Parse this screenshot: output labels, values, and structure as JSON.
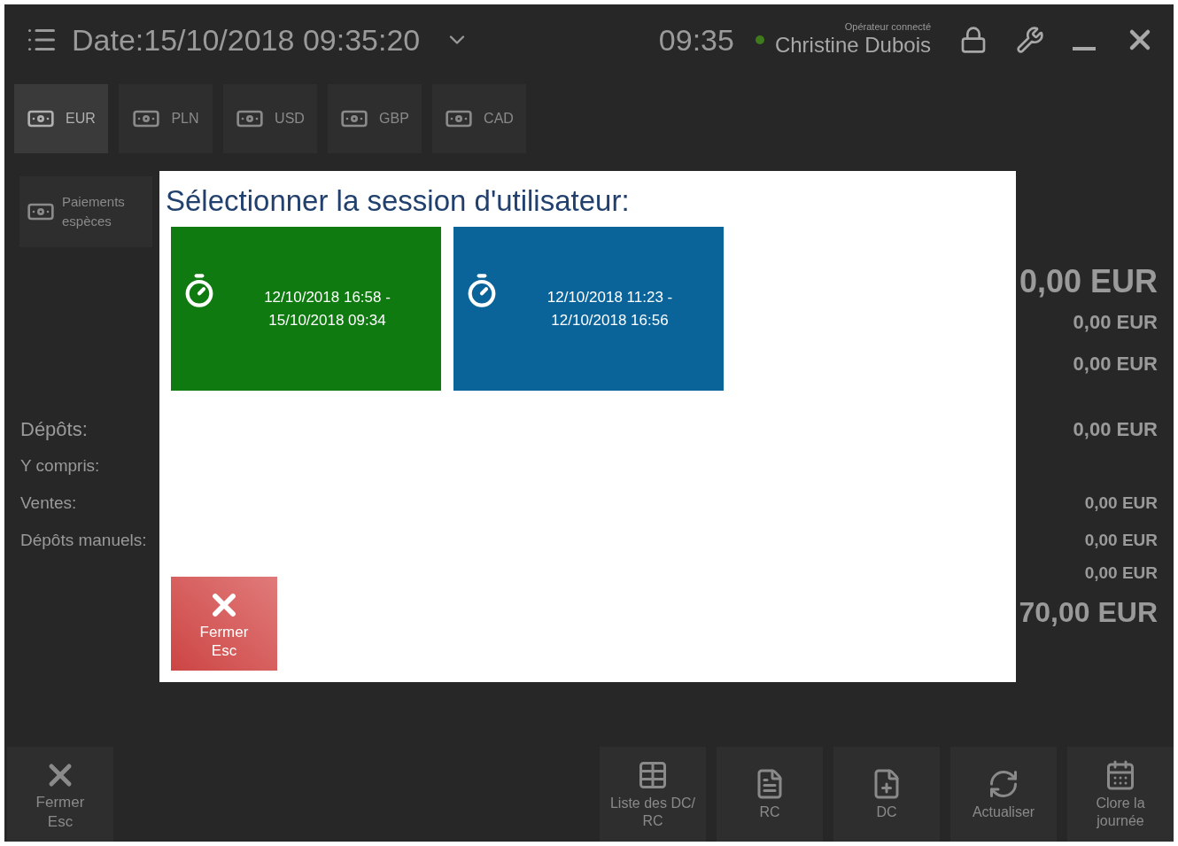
{
  "header": {
    "date": "Date:15/10/2018 09:35:20",
    "time": "09:35",
    "operator_label": "Opérateur connecté",
    "operator": "Christine Dubois"
  },
  "currencies": [
    {
      "label": "EUR",
      "selected": true
    },
    {
      "label": "PLN",
      "selected": false
    },
    {
      "label": "USD",
      "selected": false
    },
    {
      "label": "GBP",
      "selected": false
    },
    {
      "label": "CAD",
      "selected": false
    }
  ],
  "cash_button": {
    "label": "Paiements espèces"
  },
  "summary": {
    "total_top": "0,00 EUR",
    "amounts_top": [
      "0,00 EUR",
      "0,00 EUR"
    ],
    "rows": [
      {
        "label": "Dépôts:",
        "value": "0,00 EUR",
        "big": true
      },
      {
        "label": "Y compris:",
        "value": "",
        "big": false
      },
      {
        "label": "Ventes:",
        "value": "0,00 EUR",
        "big": false
      },
      {
        "label": "Dépôts manuels:",
        "value": "0,00 EUR",
        "big": false
      }
    ],
    "amount_cut": "0,00 EUR",
    "total_bottom": "70,00 EUR"
  },
  "toolbar": {
    "close": {
      "label": "Fermer",
      "key": "Esc"
    },
    "buttons": [
      {
        "kind": "list",
        "label": "Liste des DC/ RC"
      },
      {
        "kind": "file",
        "label": "RC"
      },
      {
        "kind": "file-plus",
        "label": "DC"
      },
      {
        "kind": "refresh",
        "label": "Actualiser"
      },
      {
        "kind": "calendar",
        "label": "Clore la journée"
      }
    ]
  },
  "dialog": {
    "title": "Sélectionner la session d'utilisateur:",
    "sessions": [
      {
        "line1": "12/10/2018 16:58 -",
        "line2": "15/10/2018 09:34",
        "color": "#0f7a0f"
      },
      {
        "line1": "12/10/2018 11:23 -",
        "line2": "12/10/2018 16:56",
        "color": "#0a6399"
      }
    ],
    "close": {
      "label": "Fermer",
      "key": "Esc"
    }
  }
}
